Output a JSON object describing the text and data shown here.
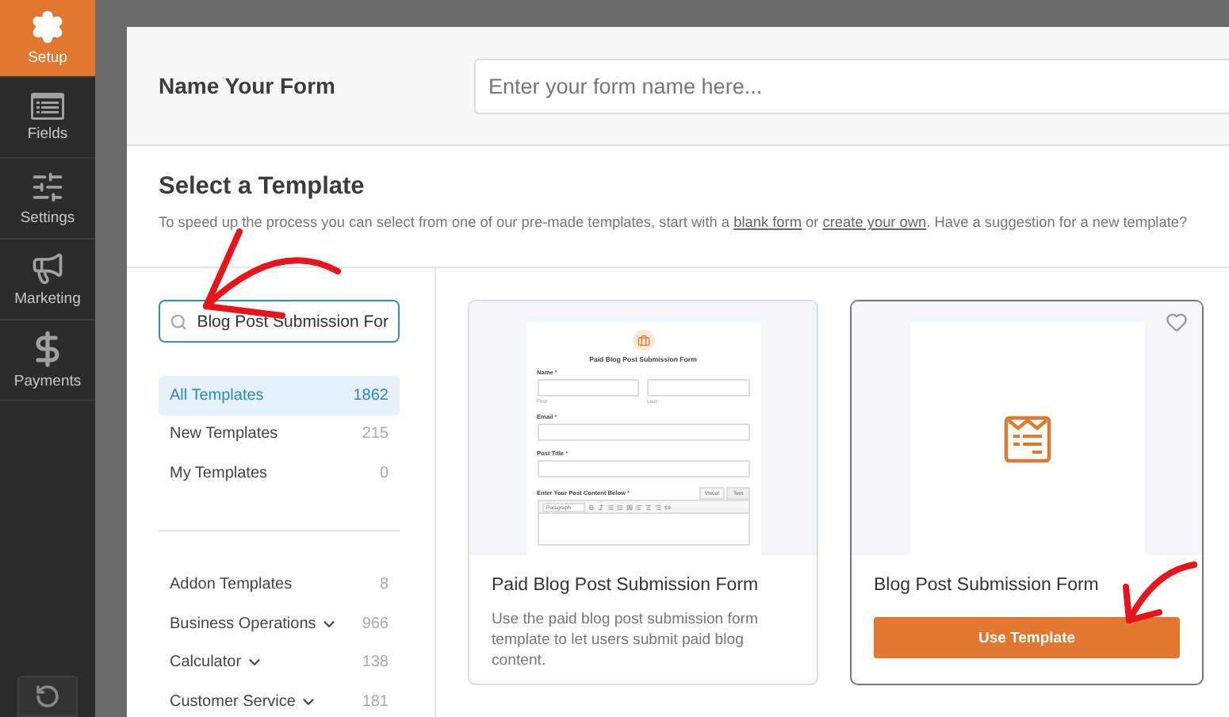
{
  "sidebar": {
    "items": [
      {
        "label": "Setup",
        "selected": true
      },
      {
        "label": "Fields",
        "selected": false
      },
      {
        "label": "Settings",
        "selected": false
      },
      {
        "label": "Marketing",
        "selected": false
      },
      {
        "label": "Payments",
        "selected": false
      }
    ]
  },
  "header": {
    "label": "Name Your Form",
    "name_field": {
      "placeholder": "Enter your form name here..."
    }
  },
  "templates": {
    "title": "Select a Template",
    "description": [
      {
        "kind": "text",
        "text": "To speed up the process you can select from one of our pre-made templates, start with a "
      },
      {
        "kind": "link",
        "text": "blank form"
      },
      {
        "kind": "text",
        "text": " or "
      },
      {
        "kind": "link",
        "text": "create your own"
      },
      {
        "kind": "text",
        "text": ". Have a suggestion for a new template?"
      }
    ]
  },
  "search": {
    "value": "Blog Post Submission For"
  },
  "main_categories": [
    {
      "label": "All Templates",
      "count": "1862",
      "selected": true,
      "has_submenu": false
    },
    {
      "label": "New Templates",
      "count": "215",
      "selected": false,
      "has_submenu": false
    },
    {
      "label": "My Templates",
      "count": "0",
      "selected": false,
      "has_submenu": false
    }
  ],
  "categories": [
    {
      "label": "Addon Templates",
      "count": "8",
      "selected": false,
      "has_submenu": false
    },
    {
      "label": "Business Operations",
      "count": "966",
      "selected": false,
      "has_submenu": true
    },
    {
      "label": "Calculator",
      "count": "138",
      "selected": false,
      "has_submenu": true
    },
    {
      "label": "Customer Service",
      "count": "181",
      "selected": false,
      "has_submenu": true
    }
  ],
  "cards": [
    {
      "title": "Paid Blog Post Submission Form",
      "description": "Use the paid blog post submission form template to let users submit paid blog content.",
      "selected": false,
      "preview": {
        "kind": "form",
        "title": "Paid Blog Post Submission Form",
        "fields": [
          {
            "kind": "name",
            "label": "Name",
            "mark": "*",
            "sublabels": [
              "First",
              "Last"
            ]
          },
          {
            "kind": "single",
            "label": "Email",
            "mark": "*"
          },
          {
            "kind": "single",
            "label": "Post Title",
            "mark": "*"
          },
          {
            "kind": "editor",
            "label": "Enter Your Post Content Below",
            "mark": "*",
            "tabs": [
              "Visual",
              "Text"
            ],
            "format": "Paragraph"
          }
        ]
      }
    },
    {
      "title": "Blog Post Submission Form",
      "button": "Use Template",
      "selected": true,
      "preview": {
        "kind": "icon"
      }
    }
  ]
}
